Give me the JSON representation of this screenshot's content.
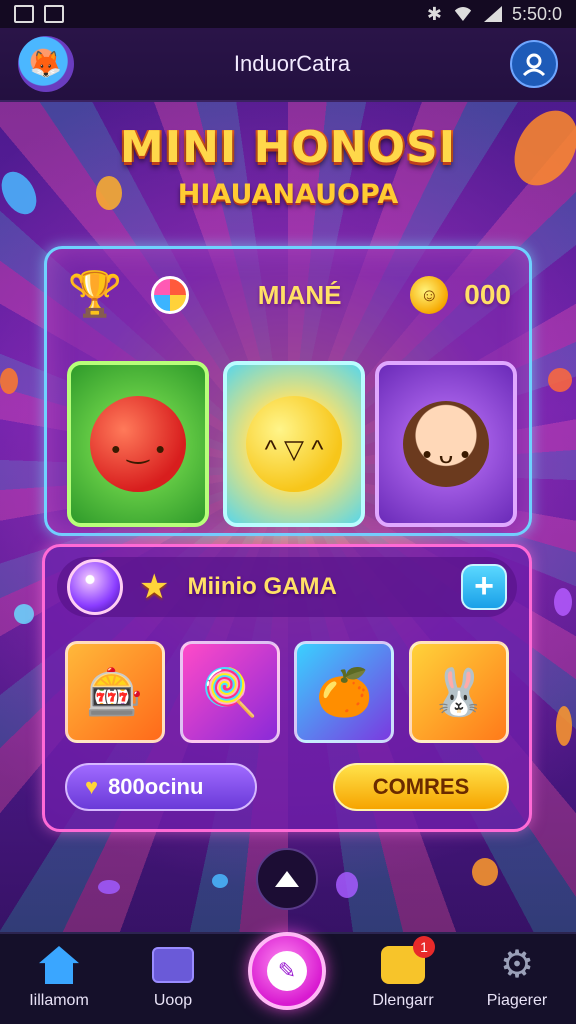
{
  "status_bar": {
    "time": "5:50:0"
  },
  "app_bar": {
    "title": "InduorCatra"
  },
  "headline": {
    "title": "MINI HONOSI",
    "subtitle": "HIAUANAUOPA"
  },
  "top_panel": {
    "label": "MIANÉ",
    "coins": "000"
  },
  "bottom_panel": {
    "label": "Miinio GAMA",
    "add_symbol": "+",
    "left_button": "800ocinu",
    "right_button": "COMRES"
  },
  "bottom_nav": {
    "items": [
      {
        "label": "Iillamom",
        "icon": "home-icon"
      },
      {
        "label": "Uoop",
        "icon": "shop-icon"
      },
      {
        "label": "Dlengarr",
        "icon": "messages-icon",
        "badge": "1"
      },
      {
        "label": "Piagerer",
        "icon": "settings-icon"
      }
    ]
  },
  "colors": {
    "accent_yellow": "#ffd84a",
    "panel_border_cyan": "#6fd2ff",
    "panel_border_pink": "#ff6ad6",
    "fab_magenta": "#d81ad0"
  }
}
